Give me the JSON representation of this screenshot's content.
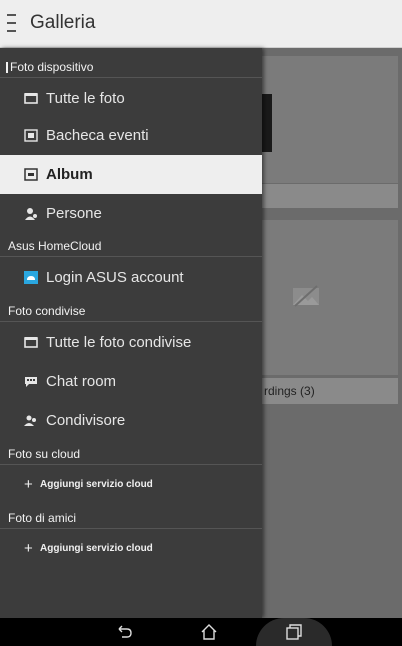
{
  "header": {
    "title": "Galleria"
  },
  "drawer": {
    "sections": [
      {
        "label": "Foto dispositivo"
      },
      {
        "label": "Asus HomeCloud"
      },
      {
        "label": "Foto condivise"
      },
      {
        "label": "Foto su cloud"
      },
      {
        "label": "Foto di amici"
      }
    ],
    "items": [
      {
        "label": "Tutte le foto",
        "icon": "photos-icon"
      },
      {
        "label": "Bacheca eventi",
        "icon": "event-board-icon"
      },
      {
        "label": "Album",
        "icon": "album-icon",
        "selected": true
      },
      {
        "label": "Persone",
        "icon": "people-icon"
      },
      {
        "label": "Login ASUS account",
        "icon": "cloud-login-icon"
      },
      {
        "label": "Tutte le foto condivise",
        "icon": "shared-photos-icon"
      },
      {
        "label": "Chat room",
        "icon": "chat-icon"
      },
      {
        "label": "Condivisore",
        "icon": "sharer-icon"
      }
    ],
    "add_cloud": [
      {
        "label": "Aggiungi servizio cloud"
      },
      {
        "label": "Aggiungi servizio cloud"
      }
    ]
  },
  "background": {
    "album_caption": "rdings",
    "album_count": "(3)"
  },
  "colors": {
    "drawer_bg": "#3c3c3c",
    "selected_bg": "#eeeeee",
    "topbar_bg": "#eeeeee",
    "cloud_icon": "#2aa7e0"
  }
}
